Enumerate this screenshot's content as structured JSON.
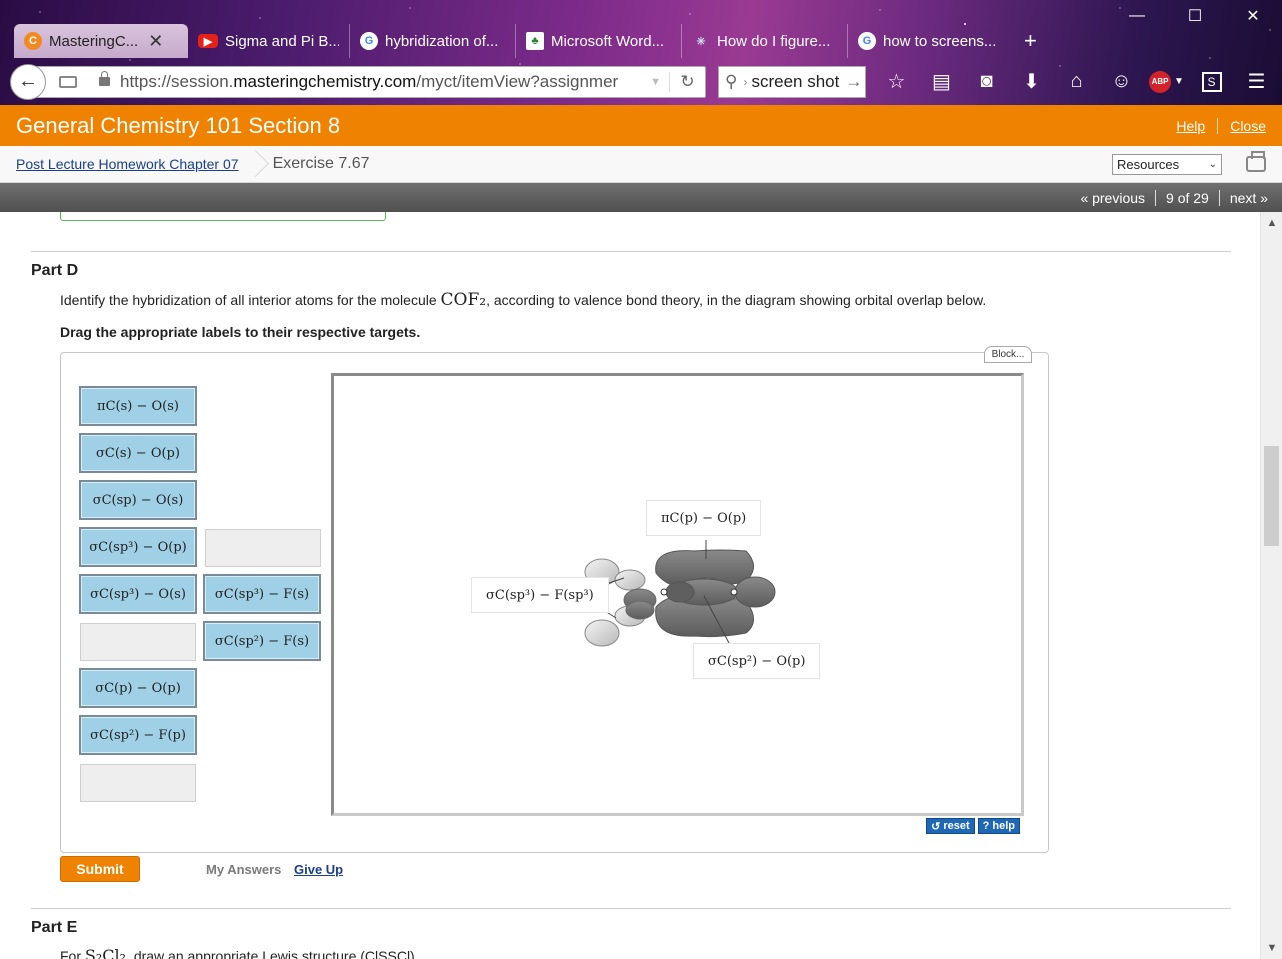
{
  "browser": {
    "tabs": [
      {
        "label": "MasteringC...",
        "icon": "mastering-icon",
        "active": true
      },
      {
        "label": "Sigma and Pi B...",
        "icon": "youtube-icon"
      },
      {
        "label": "hybridization of...",
        "icon": "google-icon"
      },
      {
        "label": "Microsoft Word...",
        "icon": "leaf-icon"
      },
      {
        "label": "How do I figure...",
        "icon": "sparkle-icon"
      },
      {
        "label": "how to screens...",
        "icon": "google-icon"
      }
    ],
    "url_prefix": "https://session.",
    "url_host": "masteringchemistry.com",
    "url_path": "/myct/itemView?assignmer",
    "search_text": "screen shot"
  },
  "app": {
    "title": "General Chemistry 101 Section 8",
    "help": "Help",
    "close": "Close",
    "breadcrumb_link": "Post Lecture Homework Chapter 07",
    "breadcrumb_current": "Exercise 7.67",
    "resources": "Resources",
    "pager": {
      "previous": "« previous",
      "position": "9 of 29",
      "next": "next »"
    }
  },
  "partD": {
    "title": "Part D",
    "prompt_before": "Identify the hybridization of all interior atoms for the molecule ",
    "molecule": "COF₂",
    "prompt_after": ", according to valence bond theory, in the diagram showing orbital overlap below.",
    "instruction": "Drag the appropriate labels to their respective targets.",
    "block_button": "Block...",
    "labels": [
      "πC(s) − O(s)",
      "σC(s) − O(p)",
      "σC(sp) − O(s)",
      "σC(sp³) − O(p)",
      "σC(sp³) − O(s)",
      "σC(sp³) − F(s)",
      "σC(sp²) − F(s)",
      "σC(p) − O(p)",
      "σC(sp²) − F(p)"
    ],
    "targets": [
      "πC(p) − O(p)",
      "σC(sp³) − F(sp³)",
      "σC(sp²) − O(p)"
    ],
    "reset": "reset",
    "help": "help",
    "submit": "Submit",
    "my_answers": "My Answers",
    "give_up": "Give Up"
  },
  "partE": {
    "title": "Part E",
    "text_before": "For ",
    "molecule": "S₂Cl₂",
    "text_after": ", draw an appropriate Lewis structure (ClSSCl)."
  },
  "colors": {
    "accent": "#ef8200",
    "chip": "#9fd0e6",
    "link": "#1a3f8a",
    "orbital": "#6e6e6e"
  }
}
